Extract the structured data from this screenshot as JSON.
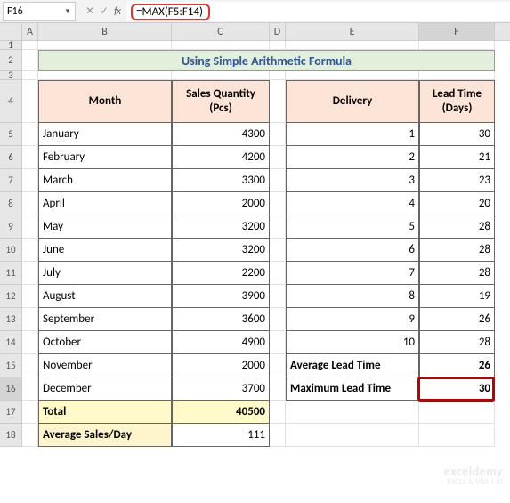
{
  "name_box": "F16",
  "formula": "=MAX(F5:F14)",
  "columns": [
    "A",
    "B",
    "C",
    "D",
    "E",
    "F"
  ],
  "rows": [
    "1",
    "2",
    "3",
    "4",
    "5",
    "6",
    "7",
    "8",
    "9",
    "10",
    "11",
    "12",
    "13",
    "14",
    "15",
    "16",
    "17",
    "18"
  ],
  "title": "Using Simple Arithmetic Formula",
  "left_table": {
    "header_month": "Month",
    "header_qty": "Sales Quantity (Pcs)",
    "rows": [
      {
        "m": "January",
        "v": "4300"
      },
      {
        "m": "February",
        "v": "4200"
      },
      {
        "m": "March",
        "v": "3300"
      },
      {
        "m": "April",
        "v": "2000"
      },
      {
        "m": "May",
        "v": "3200"
      },
      {
        "m": "June",
        "v": "3200"
      },
      {
        "m": "July",
        "v": "2200"
      },
      {
        "m": "August",
        "v": "3900"
      },
      {
        "m": "September",
        "v": "3600"
      },
      {
        "m": "October",
        "v": "4900"
      },
      {
        "m": "November",
        "v": "2000"
      },
      {
        "m": "December",
        "v": "3700"
      }
    ],
    "total_label": "Total",
    "total_value": "40500",
    "avg_label": "Average Sales/Day",
    "avg_value": "111"
  },
  "right_table": {
    "header_delivery": "Delivery",
    "header_lead": "Lead Time (Days)",
    "rows": [
      {
        "d": "1",
        "l": "30"
      },
      {
        "d": "2",
        "l": "21"
      },
      {
        "d": "3",
        "l": "23"
      },
      {
        "d": "4",
        "l": "20"
      },
      {
        "d": "5",
        "l": "28"
      },
      {
        "d": "6",
        "l": "28"
      },
      {
        "d": "7",
        "l": "28"
      },
      {
        "d": "8",
        "l": "19"
      },
      {
        "d": "9",
        "l": "26"
      },
      {
        "d": "10",
        "l": "28"
      }
    ],
    "avg_label": "Average Lead Time",
    "avg_value": "26",
    "max_label": "Maximum Lead Time",
    "max_value": "30"
  },
  "watermark": {
    "big": "exceldemy",
    "small": "EXCEL & VBA + BI"
  },
  "chart_data": {
    "type": "table",
    "title": "Using Simple Arithmetic Formula",
    "tables": [
      {
        "columns": [
          "Month",
          "Sales Quantity (Pcs)"
        ],
        "rows": [
          [
            "January",
            4300
          ],
          [
            "February",
            4200
          ],
          [
            "March",
            3300
          ],
          [
            "April",
            2000
          ],
          [
            "May",
            3200
          ],
          [
            "June",
            3200
          ],
          [
            "July",
            2200
          ],
          [
            "August",
            3900
          ],
          [
            "September",
            3600
          ],
          [
            "October",
            4900
          ],
          [
            "November",
            2000
          ],
          [
            "December",
            3700
          ]
        ],
        "summary": {
          "Total": 40500,
          "Average Sales/Day": 111
        }
      },
      {
        "columns": [
          "Delivery",
          "Lead Time (Days)"
        ],
        "rows": [
          [
            1,
            30
          ],
          [
            2,
            21
          ],
          [
            3,
            23
          ],
          [
            4,
            20
          ],
          [
            5,
            28
          ],
          [
            6,
            28
          ],
          [
            7,
            28
          ],
          [
            8,
            19
          ],
          [
            9,
            26
          ],
          [
            10,
            28
          ]
        ],
        "summary": {
          "Average Lead Time": 26,
          "Maximum Lead Time": 30
        }
      }
    ]
  }
}
